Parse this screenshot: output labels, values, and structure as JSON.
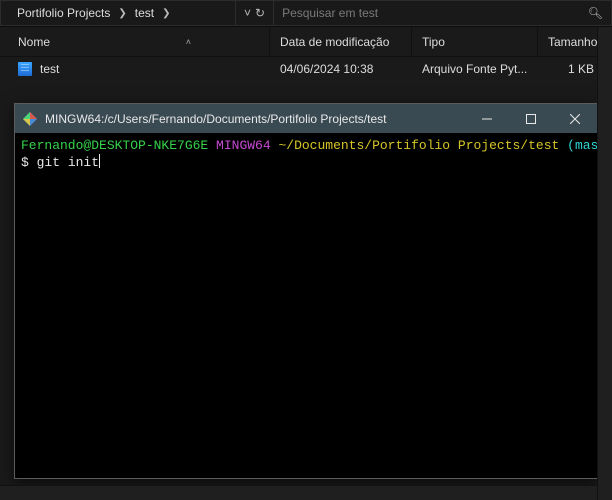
{
  "breadcrumb": {
    "seg1": "Portifolio Projects",
    "seg2": "test"
  },
  "search": {
    "placeholder": "Pesquisar em test"
  },
  "columns": {
    "name": "Nome",
    "date": "Data de modificação",
    "type": "Tipo",
    "size": "Tamanho"
  },
  "files": [
    {
      "name": "test",
      "date": "04/06/2024 10:38",
      "type": "Arquivo Fonte Pyt...",
      "size": "1 KB"
    }
  ],
  "terminal": {
    "title": "MINGW64:/c/Users/Fernando/Documents/Portifolio Projects/test",
    "prompt_user": "Fernando@DESKTOP-NKE7G6E",
    "prompt_env": "MINGW64",
    "prompt_path": "~/Documents/Portifolio Projects/test",
    "prompt_branch": "(master)",
    "ps1": "$ ",
    "command": "git init"
  }
}
